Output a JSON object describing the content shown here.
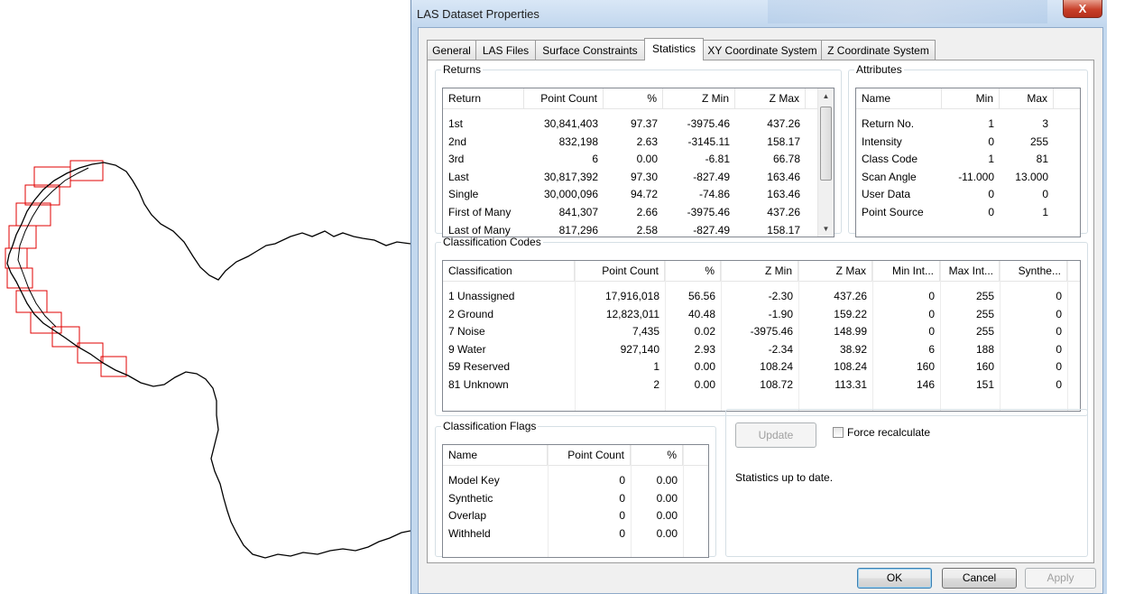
{
  "window": {
    "title": "LAS Dataset Properties",
    "close_label": "X"
  },
  "tabs": [
    "General",
    "LAS Files",
    "Surface Constraints",
    "Statistics",
    "XY Coordinate System",
    "Z Coordinate System"
  ],
  "active_tab": "Statistics",
  "returns": {
    "legend": "Returns",
    "columns": [
      "Return",
      "Point Count",
      "%",
      "Z Min",
      "Z Max"
    ],
    "rows": [
      [
        "1st",
        "30,841,403",
        "97.37",
        "-3975.46",
        "437.26"
      ],
      [
        "2nd",
        "832,198",
        "2.63",
        "-3145.11",
        "158.17"
      ],
      [
        "3rd",
        "6",
        "0.00",
        "-6.81",
        "66.78"
      ],
      [
        "Last",
        "30,817,392",
        "97.30",
        "-827.49",
        "163.46"
      ],
      [
        "Single",
        "30,000,096",
        "94.72",
        "-74.86",
        "163.46"
      ],
      [
        "First of Many",
        "841,307",
        "2.66",
        "-3975.46",
        "437.26"
      ],
      [
        "Last of Many",
        "817,296",
        "2.58",
        "-827.49",
        "158.17"
      ]
    ]
  },
  "attributes": {
    "legend": "Attributes",
    "columns": [
      "Name",
      "Min",
      "Max"
    ],
    "rows": [
      [
        "Return No.",
        "1",
        "3"
      ],
      [
        "Intensity",
        "0",
        "255"
      ],
      [
        "Class Code",
        "1",
        "81"
      ],
      [
        "Scan Angle",
        "-11.000",
        "13.000"
      ],
      [
        "User Data",
        "0",
        "0"
      ],
      [
        "Point Source",
        "0",
        "1"
      ]
    ]
  },
  "classification_codes": {
    "legend": "Classification Codes",
    "columns": [
      "Classification",
      "Point Count",
      "%",
      "Z Min",
      "Z Max",
      "Min Int...",
      "Max Int...",
      "Synthe..."
    ],
    "rows": [
      [
        "1 Unassigned",
        "17,916,018",
        "56.56",
        "-2.30",
        "437.26",
        "0",
        "255",
        "0"
      ],
      [
        "2 Ground",
        "12,823,011",
        "40.48",
        "-1.90",
        "159.22",
        "0",
        "255",
        "0"
      ],
      [
        "7 Noise",
        "7,435",
        "0.02",
        "-3975.46",
        "148.99",
        "0",
        "255",
        "0"
      ],
      [
        "9 Water",
        "927,140",
        "2.93",
        "-2.34",
        "38.92",
        "6",
        "188",
        "0"
      ],
      [
        "59 Reserved",
        "1",
        "0.00",
        "108.24",
        "108.24",
        "160",
        "160",
        "0"
      ],
      [
        "81 Unknown",
        "2",
        "0.00",
        "108.72",
        "113.31",
        "146",
        "151",
        "0"
      ]
    ]
  },
  "classification_flags": {
    "legend": "Classification Flags",
    "columns": [
      "Name",
      "Point Count",
      "%"
    ],
    "rows": [
      [
        "Model Key",
        "0",
        "0.00"
      ],
      [
        "Synthetic",
        "0",
        "0.00"
      ],
      [
        "Overlap",
        "0",
        "0.00"
      ],
      [
        "Withheld",
        "0",
        "0.00"
      ]
    ]
  },
  "update_panel": {
    "update_label": "Update",
    "force_label": "Force recalculate",
    "force_checked": false,
    "status": "Statistics up to date."
  },
  "footer": {
    "ok_label": "OK",
    "cancel_label": "Cancel",
    "apply_label": "Apply"
  },
  "colors": {
    "tile_outline": "#e00000",
    "boundary_line": "#000000",
    "window_frame": "#c3d8ee",
    "close_button": "#c8402a"
  }
}
